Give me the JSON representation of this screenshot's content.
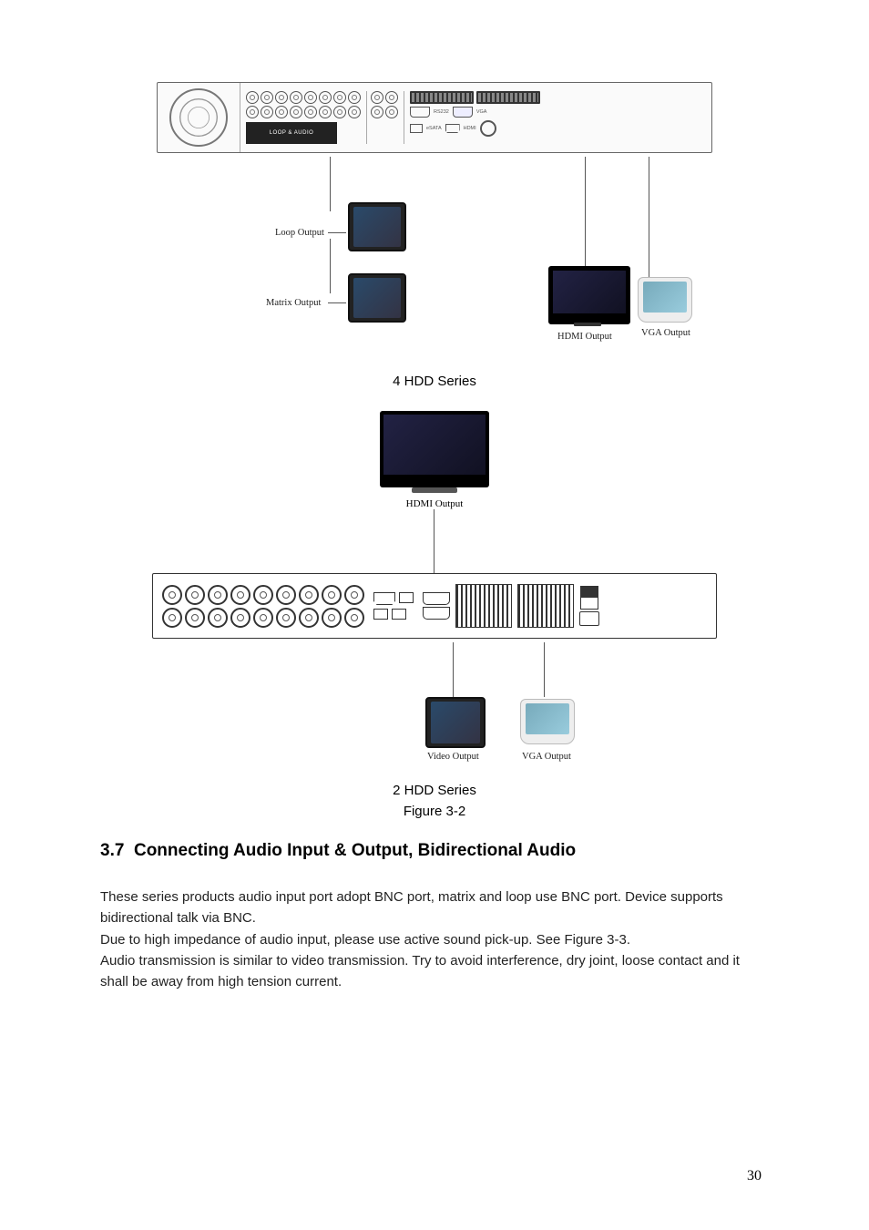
{
  "figure1": {
    "panel_labels": {
      "loop_audio": "LOOP & AUDIO",
      "rs232": "RS232",
      "vga": "VGA",
      "esata": "eSATA",
      "hdmi": "HDMI"
    },
    "callouts": {
      "loop_output": "Loop Output",
      "matrix_output": "Matrix Output",
      "hdmi_output": "HDMI Output",
      "vga_output": "VGA Output"
    },
    "caption": "4 HDD Series"
  },
  "figure2": {
    "callouts": {
      "hdmi_output": "HDMI Output",
      "video_output": "Video Output",
      "vga_output": "VGA Output"
    },
    "caption": "2 HDD Series",
    "figure_label": "Figure 3-2"
  },
  "section": {
    "number": "3.7",
    "title": "Connecting Audio Input & Output, Bidirectional Audio"
  },
  "body": {
    "p1": "These series products audio input port adopt BNC port, matrix and loop use BNC port. Device supports bidirectional talk via BNC.",
    "p2": "Due to high impedance of audio input, please use active sound pick-up. See Figure 3-3.",
    "p3": "Audio transmission is similar to video transmission. Try to avoid interference, dry joint, loose contact and it shall be away from high tension current."
  },
  "page_number": "30"
}
